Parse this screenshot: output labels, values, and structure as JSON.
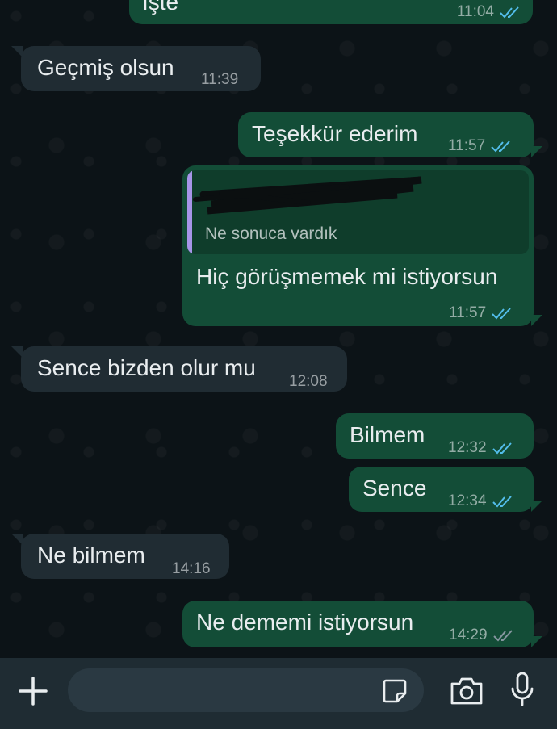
{
  "messages": [
    {
      "dir": "out",
      "text": "İşte",
      "time": "11:04",
      "status": "read"
    },
    {
      "dir": "in",
      "text": "Geçmiş olsun",
      "time": "11:39"
    },
    {
      "dir": "out",
      "text": "Teşekkür ederim",
      "time": "11:57",
      "status": "read"
    },
    {
      "dir": "out",
      "quote": "Ne sonuca vardık",
      "text": "Hiç görüşmemek mi istiyorsun",
      "time": "11:57",
      "status": "read"
    },
    {
      "dir": "in",
      "text": "Sence bizden olur mu",
      "time": "12:08"
    },
    {
      "dir": "out",
      "text": "Bilmem",
      "time": "12:32",
      "status": "read"
    },
    {
      "dir": "out",
      "text": "Sence",
      "time": "12:34",
      "status": "read"
    },
    {
      "dir": "in",
      "text": "Ne bilmem",
      "time": "14:16"
    },
    {
      "dir": "out",
      "text": "Ne dememi istiyorsun",
      "time": "14:29",
      "status": "delivered"
    }
  ],
  "colors": {
    "read_tick": "#53bdeb",
    "delivered_tick": "#8696a0",
    "outgoing": "#134d37",
    "incoming": "#202c33"
  },
  "input_bar": {
    "icons": [
      "plus-icon",
      "sticker-icon",
      "camera-icon",
      "microphone-icon"
    ]
  }
}
